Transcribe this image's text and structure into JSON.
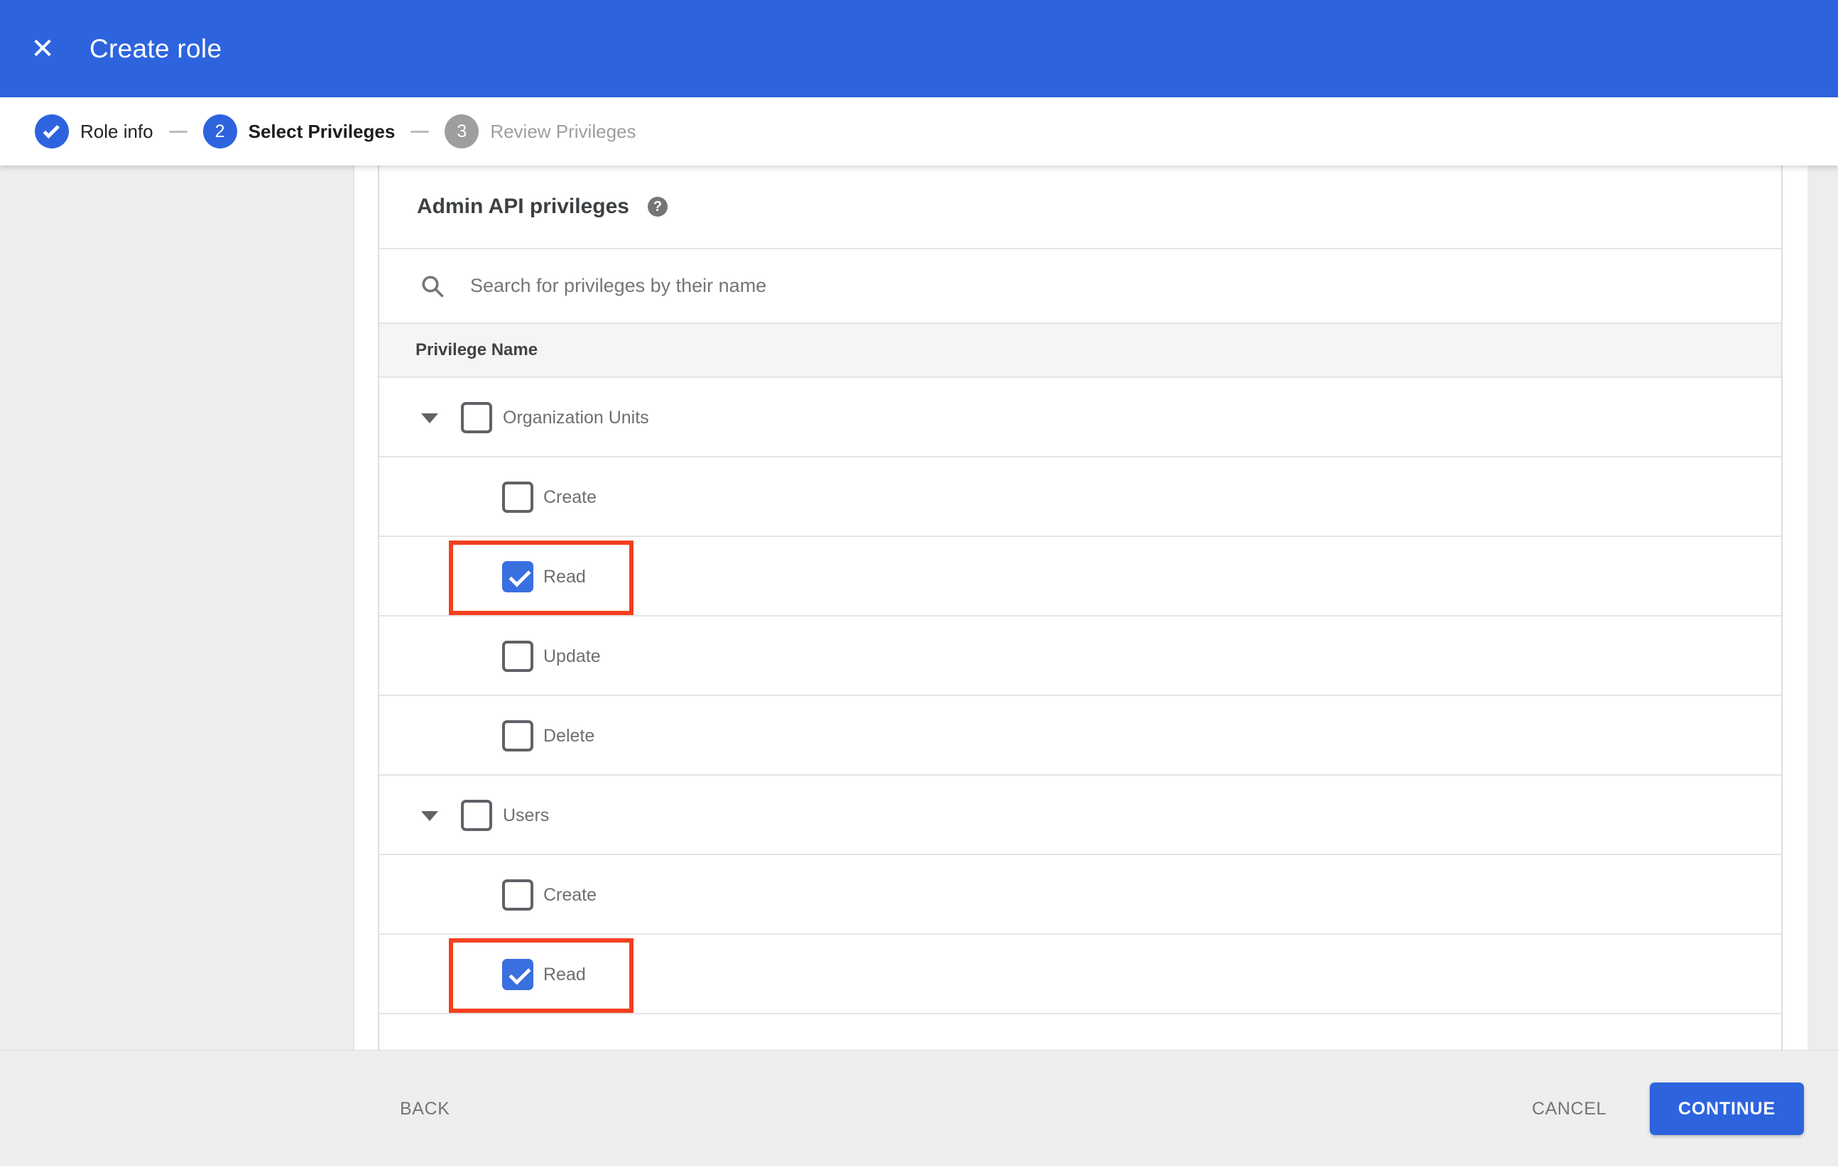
{
  "app_bar": {
    "title": "Create role",
    "close_icon_glyph": "✕"
  },
  "stepper": {
    "steps": [
      {
        "number": "1",
        "label": "Role info",
        "state": "complete"
      },
      {
        "number": "2",
        "label": "Select Privileges",
        "state": "active"
      },
      {
        "number": "3",
        "label": "Review Privileges",
        "state": "upcoming"
      }
    ]
  },
  "privileges_panel": {
    "heading": "Admin API privileges",
    "help_icon_glyph": "?",
    "search": {
      "placeholder": "Search for privileges by their name",
      "value": ""
    },
    "table": {
      "header": "Privilege Name",
      "rows": [
        {
          "type": "group",
          "label": "Organization Units",
          "checked": false,
          "expanded": true
        },
        {
          "type": "child",
          "label": "Create",
          "checked": false
        },
        {
          "type": "child",
          "label": "Read",
          "checked": true,
          "highlight": true
        },
        {
          "type": "child",
          "label": "Update",
          "checked": false
        },
        {
          "type": "child",
          "label": "Delete",
          "checked": false
        },
        {
          "type": "group",
          "label": "Users",
          "checked": false,
          "expanded": true
        },
        {
          "type": "child",
          "label": "Create",
          "checked": false
        },
        {
          "type": "child",
          "label": "Read",
          "checked": true,
          "highlight": true
        }
      ]
    }
  },
  "footer": {
    "back_label": "BACK",
    "cancel_label": "CANCEL",
    "continue_label": "CONTINUE"
  },
  "colors": {
    "app_bar_blue": "#2d64de",
    "checkbox_checked_blue": "#3a6fe0",
    "highlight_red": "#f4401f",
    "step_upcoming_gray": "#9e9e9e",
    "sidebar_gray": "#eeeeee",
    "header_row_gray": "#f5f5f5"
  }
}
